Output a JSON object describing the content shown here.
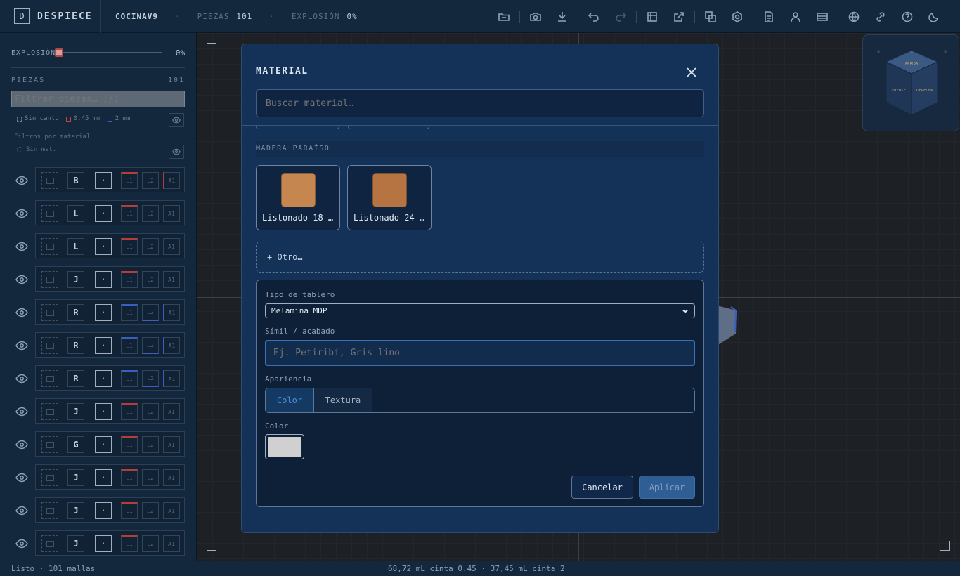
{
  "app": {
    "mark": "D",
    "name": "DESPIECE"
  },
  "header": {
    "project": "COCINAV9",
    "sep": "·",
    "piezas_label": "PIEZAS",
    "piezas_value": "101",
    "explosion_label": "EXPLOSIÓN",
    "explosion_value": "0%"
  },
  "toolbar_icons": [
    "folder-icon",
    "camera-icon",
    "download-icon",
    "undo-icon",
    "redo-icon",
    "cutlist-icon",
    "export-icon",
    "duplicate-icon",
    "settings-icon",
    "document-icon",
    "user-icon",
    "card-icon",
    "globe-icon",
    "link-icon",
    "help-icon",
    "moon-icon"
  ],
  "sidebar": {
    "explosion_label": "EXPLOSIÓN",
    "explosion_value": "0%",
    "explosion_level": 0,
    "piezas_label": "PIEZAS",
    "piezas_count": "101",
    "filter_placeholder": "Filtrar piezas… (/)",
    "legend": {
      "sin_canto": "Sin canto",
      "thin": "0,45 mm",
      "thick": "2 mm"
    },
    "material_filters_label": "Filtros por material",
    "sin_mat": "Sin mat.",
    "rows": [
      {
        "letter": "B",
        "dot": "·",
        "l1": "L1",
        "l2": "L2",
        "a1": "A1"
      },
      {
        "letter": "L",
        "dot": "·",
        "l1": "L1",
        "l2": "L2",
        "a1": "A1"
      },
      {
        "letter": "L",
        "dot": "·",
        "l1": "L1",
        "l2": "L2",
        "a1": "A1"
      },
      {
        "letter": "J",
        "dot": "·",
        "l1": "L1",
        "l2": "L2",
        "a1": "A1"
      },
      {
        "letter": "R",
        "dot": "·",
        "l1": "L1",
        "l2": "L2",
        "a1": "A1"
      },
      {
        "letter": "R",
        "dot": "·",
        "l1": "L1",
        "l2": "L2",
        "a1": "A1"
      },
      {
        "letter": "R",
        "dot": "·",
        "l1": "L1",
        "l2": "L2",
        "a1": "A1"
      },
      {
        "letter": "J",
        "dot": "·",
        "l1": "L1",
        "l2": "L2",
        "a1": "A1"
      },
      {
        "letter": "G",
        "dot": "·",
        "l1": "L1",
        "l2": "L2",
        "a1": "A1"
      },
      {
        "letter": "J",
        "dot": "·",
        "l1": "L1",
        "l2": "L2",
        "a1": "A1"
      },
      {
        "letter": "J",
        "dot": "·",
        "l1": "L1",
        "l2": "L2",
        "a1": "A1"
      },
      {
        "letter": "J",
        "dot": "·",
        "l1": "L1",
        "l2": "L2",
        "a1": "A1"
      }
    ]
  },
  "status": {
    "left": "Listo · 101 mallas",
    "center": "68,72 mL cinta 0.45 · 37,45 mL cinta 2"
  },
  "modal": {
    "title": "MATERIAL",
    "search_placeholder": "Buscar material…",
    "section": "MADERA PARAÍSO",
    "materials": [
      {
        "name": "Listonado 18 …",
        "color": "#c68650"
      },
      {
        "name": "Listonado 24 …",
        "color": "#b57441"
      }
    ],
    "otro": "+ Otro…",
    "form": {
      "tipo_label": "Tipo de tablero",
      "tipo_value": "Melamina MDP",
      "simil_label": "Símil / acabado",
      "simil_placeholder": "Ej. Petiribí, Gris lino",
      "apariencia_label": "Apariencia",
      "apariencia_options": [
        "Color",
        "Textura"
      ],
      "apariencia_selected": "Color",
      "color_label": "Color",
      "color_value": "#d0d0d0",
      "cancel": "Cancelar",
      "apply": "Aplicar"
    }
  },
  "colors": {
    "accent": "#3b70b8",
    "edge_thin": "#b33c3c",
    "edge_thick": "#3a5fc0"
  }
}
